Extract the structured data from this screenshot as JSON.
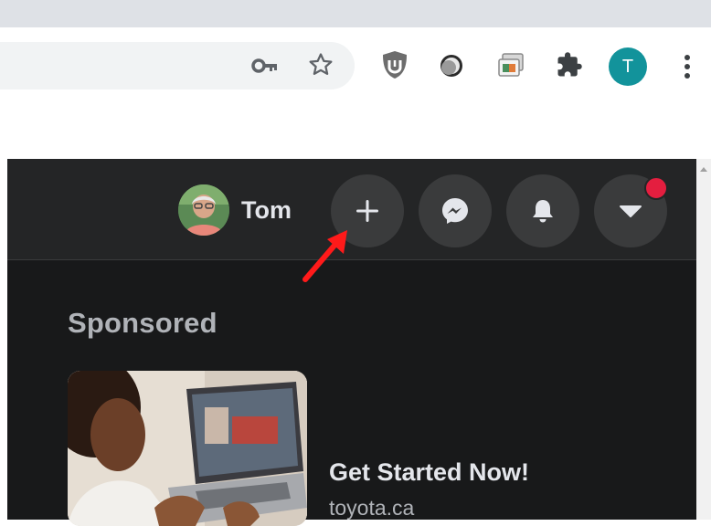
{
  "browser": {
    "profile_initial": "T",
    "icons": [
      "key-icon",
      "star-icon",
      "ublock-icon",
      "extension-icon",
      "extension-icon",
      "puzzle-icon",
      "more-vert-icon"
    ]
  },
  "facebook": {
    "user": {
      "name": "Tom"
    },
    "header_buttons": [
      "create-icon",
      "messenger-icon",
      "bell-icon",
      "caret-down-icon"
    ],
    "colors": {
      "header_bg": "#242526",
      "page_bg": "#18191a",
      "button_bg": "#3a3b3c",
      "notification_dot": "#e41e3f",
      "annotation_arrow": "#ff1a1a"
    },
    "sponsored": {
      "title": "Sponsored",
      "ad": {
        "headline": "Get Started Now!",
        "domain": "toyota.ca"
      }
    }
  }
}
